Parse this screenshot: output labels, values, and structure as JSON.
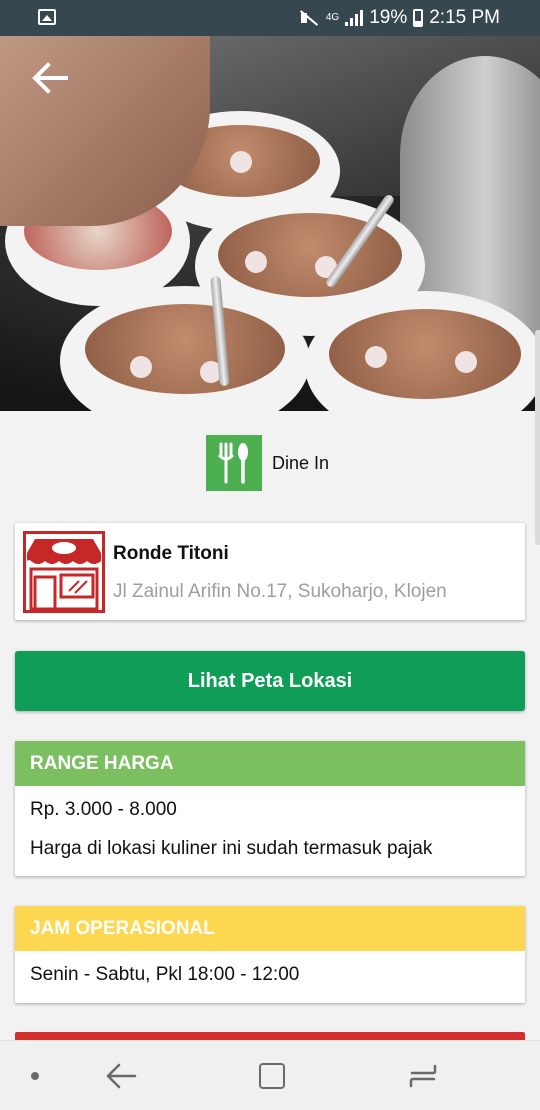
{
  "status_bar": {
    "network": "4G",
    "battery": "19%",
    "time": "2:15 PM",
    "icons": [
      "gallery-icon",
      "mute-icon",
      "signal-icon",
      "battery-icon"
    ]
  },
  "header": {
    "back_icon": "back-arrow-icon"
  },
  "dine": {
    "label": "Dine In",
    "icon": "fork-spoon-icon",
    "color": "#4caf50"
  },
  "place": {
    "name": "Ronde Titoni",
    "address": "Jl Zainul Arifin No.17, Sukoharjo, Klojen",
    "icon": "shop-icon",
    "icon_color": "#c62828"
  },
  "map_button": {
    "label": "Lihat Peta Lokasi",
    "color": "#0f9d58"
  },
  "price": {
    "title": "RANGE HARGA",
    "range": "Rp. 3.000 - 8.000",
    "note": "Harga di lokasi kuliner ini sudah termasuk pajak",
    "color": "#7cbf60"
  },
  "hours": {
    "title": "JAM OPERASIONAL",
    "schedule": "Senin - Sabtu, Pkl 18:00 - 12:00",
    "color": "#fdd74f"
  },
  "nav_bar": {
    "icons": [
      "nav-dot-icon",
      "back-icon",
      "home-icon",
      "recent-apps-icon"
    ]
  }
}
